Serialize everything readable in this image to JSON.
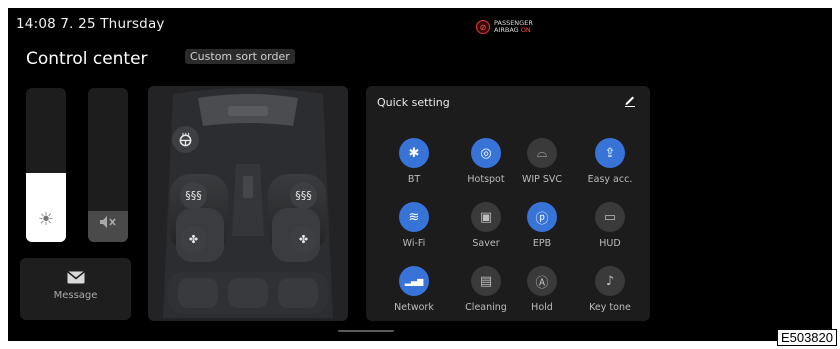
{
  "status_bar": {
    "time_date": "14:08  7. 25  Thursday"
  },
  "airbag_indicator": {
    "line1": "PASSENGER",
    "line2_prefix": "AIRBAG",
    "line2_state": "ON",
    "icon": "airbag-off-icon"
  },
  "header": {
    "title": "Control center",
    "sort_button": "Custom sort order"
  },
  "brightness_slider": {
    "icon": "sun-icon",
    "level": 0.45
  },
  "volume_slider": {
    "icon": "speaker-muted-icon",
    "level": 0.2
  },
  "message_tile": {
    "icon": "envelope-icon",
    "label": "Message"
  },
  "seat_controls": {
    "steering": "steering-wheel-heat-icon",
    "driver_heat": "seat-heat-icon",
    "passenger_heat": "seat-heat-icon",
    "driver_vent": "seat-vent-icon",
    "passenger_vent": "seat-vent-icon"
  },
  "quick_setting": {
    "title": "Quick setting",
    "edit_icon": "pencil-icon",
    "items": [
      {
        "label": "BT",
        "icon": "bluetooth-icon",
        "on": true
      },
      {
        "label": "Hotspot",
        "icon": "hotspot-icon",
        "on": true
      },
      {
        "label": "WIP SVC",
        "icon": "wiper-icon",
        "on": false
      },
      {
        "label": "Easy acc.",
        "icon": "easy-access-icon",
        "on": true
      },
      {
        "label": "Wi-Fi",
        "icon": "wifi-icon",
        "on": true
      },
      {
        "label": "Saver",
        "icon": "screen-saver-icon",
        "on": false
      },
      {
        "label": "EPB",
        "icon": "parking-brake-icon",
        "on": true
      },
      {
        "label": "HUD",
        "icon": "hud-icon",
        "on": false
      },
      {
        "label": "Network",
        "icon": "network-signal-icon",
        "on": true
      },
      {
        "label": "Cleaning",
        "icon": "cleaning-icon",
        "on": false
      },
      {
        "label": "Hold",
        "icon": "auto-hold-icon",
        "on": false
      },
      {
        "label": "Key tone",
        "icon": "key-tone-icon",
        "on": false
      }
    ]
  },
  "image_code": "E503820"
}
